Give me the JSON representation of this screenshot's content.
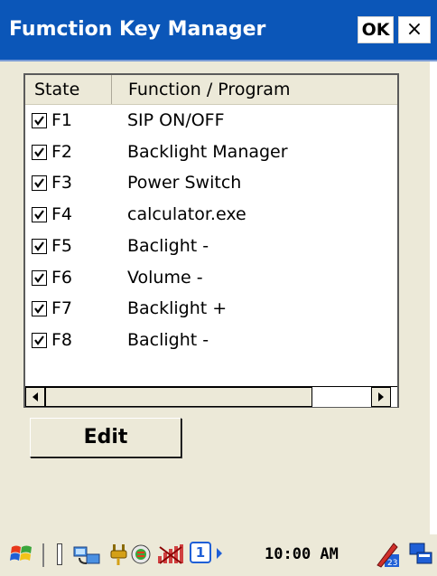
{
  "window": {
    "title": "Fumction Key Manager",
    "ok_label": "OK",
    "close_label": "×"
  },
  "list": {
    "columns": [
      "State",
      "Function / Program"
    ],
    "rows": [
      {
        "checked": true,
        "key": "F1",
        "program": "SIP ON/OFF"
      },
      {
        "checked": true,
        "key": "F2",
        "program": "Backlight Manager"
      },
      {
        "checked": true,
        "key": "F3",
        "program": "Power Switch"
      },
      {
        "checked": true,
        "key": "F4",
        "program": "calculator.exe"
      },
      {
        "checked": true,
        "key": "F5",
        "program": "Baclight -"
      },
      {
        "checked": true,
        "key": "F6",
        "program": "Volume -"
      },
      {
        "checked": true,
        "key": "F7",
        "program": "Backlight +"
      },
      {
        "checked": true,
        "key": "F8",
        "program": "Baclight -"
      }
    ]
  },
  "edit_button": {
    "label": "Edit"
  },
  "taskbar": {
    "time": "10:00 AM",
    "sim_badge": "1",
    "icons": [
      "start-flag-icon",
      "network-icon",
      "power-plug-icon",
      "sync-icon",
      "signal-off-icon",
      "sim-icon",
      "arrow-icon",
      "input-panel-icon",
      "desktop-icon"
    ]
  },
  "colors": {
    "titlebar": "#0b56b8",
    "background": "#ece9d8",
    "accent_white": "#ffffff"
  }
}
